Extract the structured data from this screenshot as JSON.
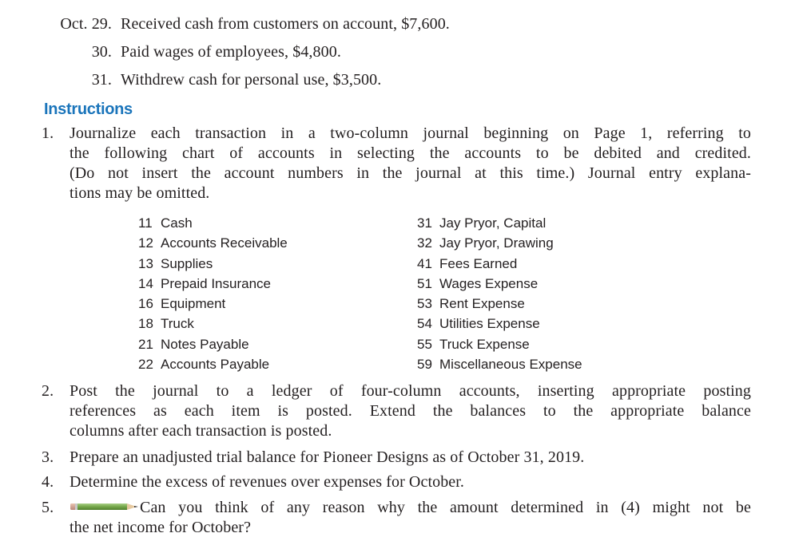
{
  "transactions": [
    {
      "date": "Oct. 29.",
      "description": "Received cash from customers on account, $7,600."
    },
    {
      "date": "30.",
      "description": "Paid wages of employees, $4,800."
    },
    {
      "date": "31.",
      "description": "Withdrew cash for personal use, $3,500."
    }
  ],
  "instructions": {
    "heading": "Instructions",
    "items": [
      {
        "number": "1.",
        "lines": [
          "Journalize each transaction in a two-column journal beginning on Page 1, referring to",
          "the following chart of accounts in selecting the accounts to be debited and credited.",
          "(Do not insert the account numbers in the journal at this time.) Journal entry explana-",
          "tions may be omitted."
        ]
      },
      {
        "number": "2.",
        "lines": [
          "Post the journal to a ledger of four-column accounts, inserting appropriate posting",
          "references as each item is posted. Extend the balances to the appropriate balance",
          "columns after each transaction is posted."
        ]
      },
      {
        "number": "3.",
        "lines": [
          "Prepare an unadjusted trial balance for Pioneer Designs as of October 31, 2019."
        ]
      },
      {
        "number": "4.",
        "lines": [
          "Determine the excess of revenues over expenses for October."
        ]
      },
      {
        "number": "5.",
        "icon": "pencil-icon",
        "lines": [
          "Can you think of any reason why the amount determined in (4) might not be",
          "the net income for October?"
        ]
      }
    ]
  },
  "chart_of_accounts": {
    "left": [
      {
        "number": "11",
        "name": "Cash"
      },
      {
        "number": "12",
        "name": "Accounts Receivable"
      },
      {
        "number": "13",
        "name": "Supplies"
      },
      {
        "number": "14",
        "name": "Prepaid Insurance"
      },
      {
        "number": "16",
        "name": "Equipment"
      },
      {
        "number": "18",
        "name": "Truck"
      },
      {
        "number": "21",
        "name": "Notes Payable"
      },
      {
        "number": "22",
        "name": "Accounts Payable"
      }
    ],
    "right": [
      {
        "number": "31",
        "name": "Jay Pryor, Capital"
      },
      {
        "number": "32",
        "name": "Jay Pryor, Drawing"
      },
      {
        "number": "41",
        "name": "Fees Earned"
      },
      {
        "number": "51",
        "name": "Wages Expense"
      },
      {
        "number": "53",
        "name": "Rent Expense"
      },
      {
        "number": "54",
        "name": "Utilities Expense"
      },
      {
        "number": "55",
        "name": "Truck Expense"
      },
      {
        "number": "59",
        "name": "Miscellaneous Expense"
      }
    ]
  },
  "colors": {
    "heading": "#1b75bb",
    "text": "#231f20",
    "pencil_body": "#7aab4f"
  }
}
